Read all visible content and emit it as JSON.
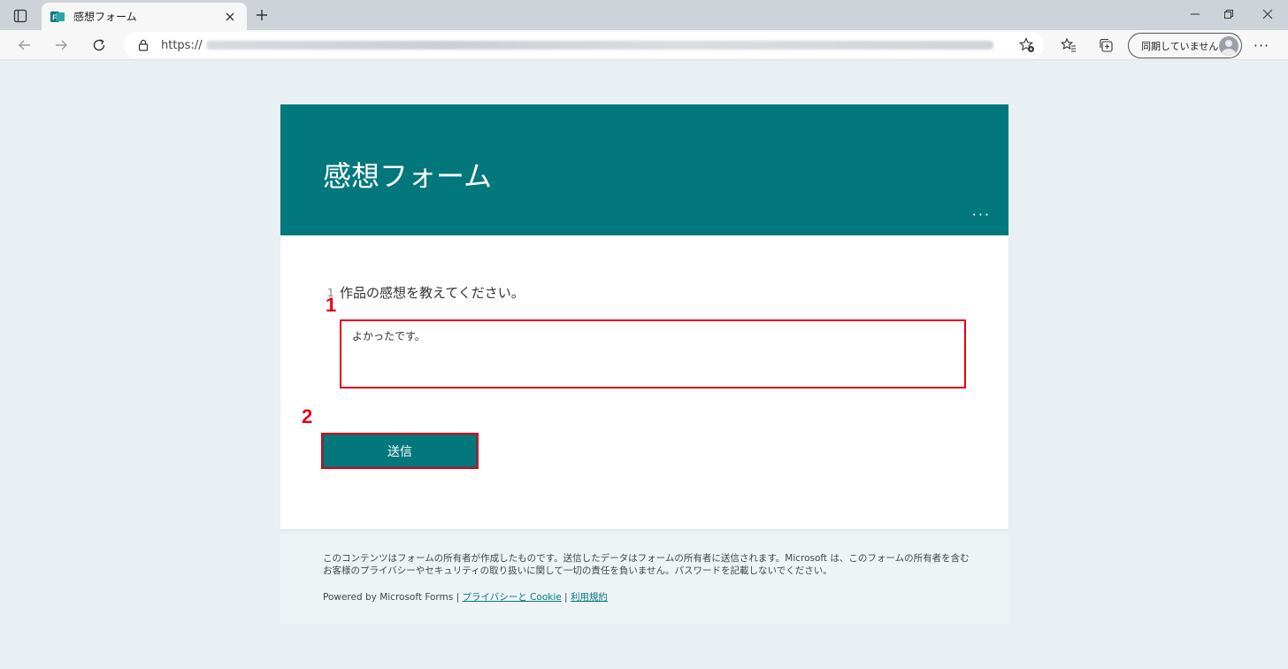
{
  "browser": {
    "tab_title": "感想フォーム",
    "url_prefix": "https://",
    "profile_label": "同期していません",
    "more_label": "···"
  },
  "form": {
    "title": "感想フォーム",
    "header_more": "···",
    "question_number": "1",
    "question_text": "作品の感想を教えてください。",
    "answer_value": "よかったです。",
    "submit_label": "送信",
    "accent_color": "#03787c"
  },
  "annotations": {
    "marker_1": "1",
    "marker_2": "2",
    "highlight_color": "#e2001a"
  },
  "footer": {
    "disclaimer": "このコンテンツはフォームの所有者が作成したものです。送信したデータはフォームの所有者に送信されます。Microsoft は、このフォームの所有者を含むお客様のプライバシーやセキュリティの取り扱いに関して一切の責任を負いません。パスワードを記載しないでください。",
    "powered_by": "Powered by Microsoft Forms | ",
    "privacy_link": "プライバシーと Cookie",
    "separator": " | ",
    "terms_link": "利用規約"
  }
}
